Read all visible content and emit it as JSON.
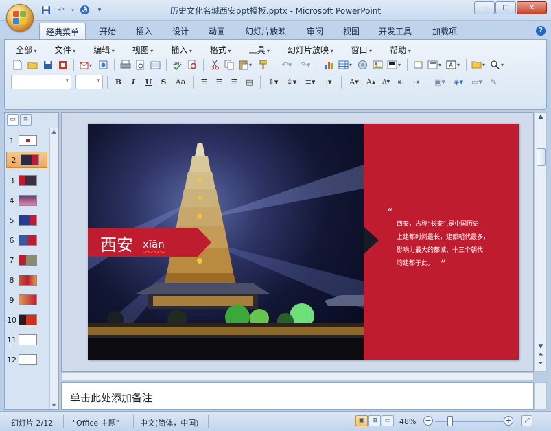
{
  "window": {
    "title": "历史文化名城西安ppt模板.pptx - Microsoft PowerPoint",
    "controls": [
      "—",
      "▢",
      "✕"
    ]
  },
  "ribbon_tabs": [
    "经典菜单",
    "开始",
    "插入",
    "设计",
    "动画",
    "幻灯片放映",
    "审阅",
    "视图",
    "开发工具",
    "加载项"
  ],
  "active_tab": "经典菜单",
  "menus": [
    "全部",
    "文件",
    "编辑",
    "视图",
    "插入",
    "格式",
    "工具",
    "幻灯片放映",
    "窗口",
    "帮助"
  ],
  "format_buttons": [
    "B",
    "I",
    "U",
    "S",
    "Aa"
  ],
  "slides": {
    "numbers": [
      "1",
      "2",
      "3",
      "4",
      "5",
      "6",
      "7",
      "8",
      "9",
      "10",
      "11",
      "12"
    ],
    "selected": 2
  },
  "slide": {
    "city_name": "西安",
    "city_pinyin": "xīān",
    "quote_open": "“",
    "quote_close": "”",
    "quote_lines": [
      "西安，古称“长安”,是中国历史",
      "上建都时间最长，建都朝代最多，",
      "影响力最大的都城，十三个朝代",
      "均建都于此。"
    ]
  },
  "notes": {
    "placeholder": "单击此处添加备注"
  },
  "status": {
    "slide_counter": "幻灯片 2/12",
    "theme": "\"Office 主题\"",
    "language": "中文(简体，中国)",
    "zoom": "48%",
    "zoom_out": "−",
    "zoom_in": "+"
  },
  "colors": {
    "accent_red": "#c01c30",
    "ribbon": "#bfd3ea"
  }
}
